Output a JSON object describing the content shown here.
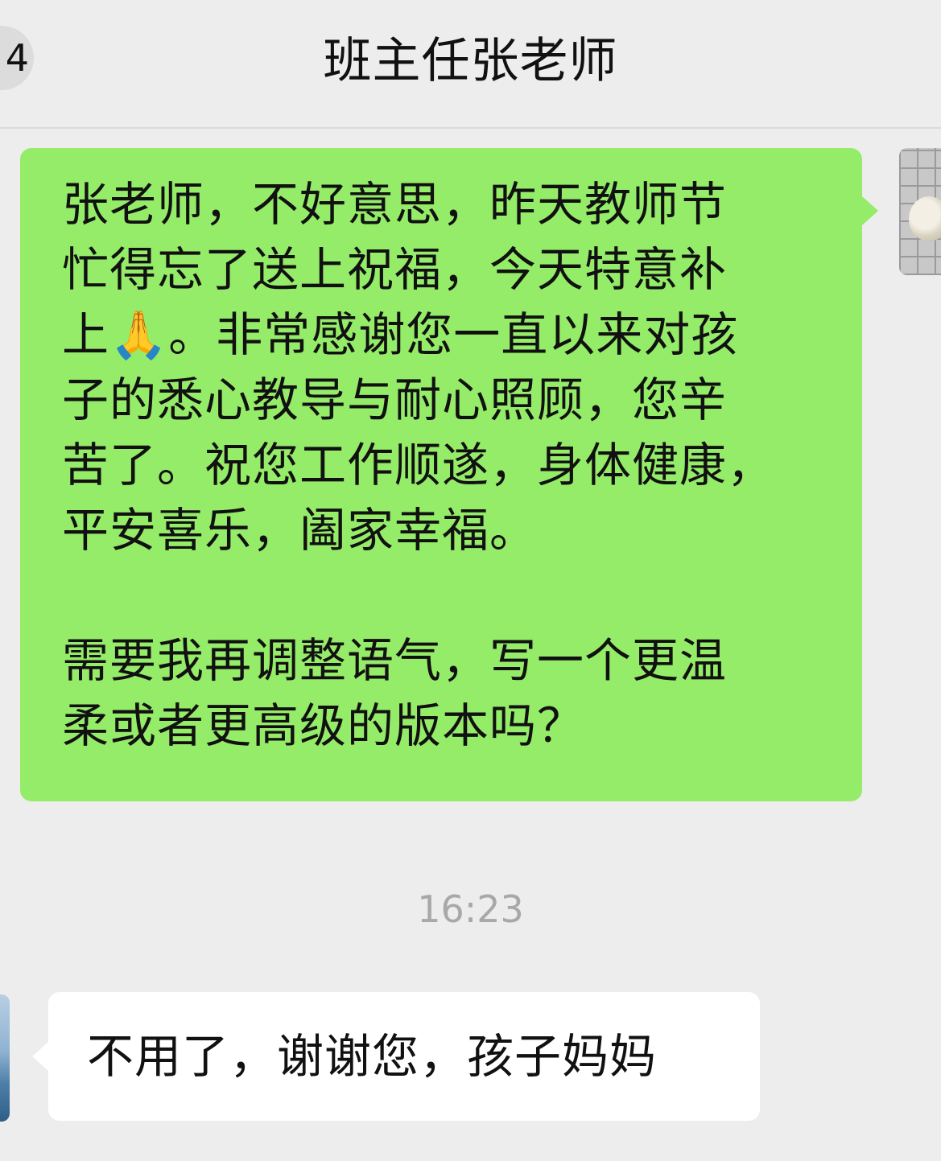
{
  "header": {
    "back_badge": "4",
    "title": "班主任张老师"
  },
  "messages": {
    "outgoing": {
      "text": "张老师，不好意思，昨天教师节\n忙得忘了送上祝福，今天特意补\n上🙏。非常感谢您一直以来对孩\n子的悉心教导与耐心照顾，您辛\n苦了。祝您工作顺遂，身体健康，\n平安喜乐，阖家幸福。\n\n需要我再调整语气，写一个更温\n柔或者更高级的版本吗？",
      "bubble_color": "#95ec69"
    },
    "timestamp": "16:23",
    "incoming": {
      "text": "不用了，谢谢您，孩子妈妈",
      "bubble_color": "#ffffff"
    }
  },
  "colors": {
    "background": "#ededed",
    "timestamp_text": "#a8a8a8"
  }
}
